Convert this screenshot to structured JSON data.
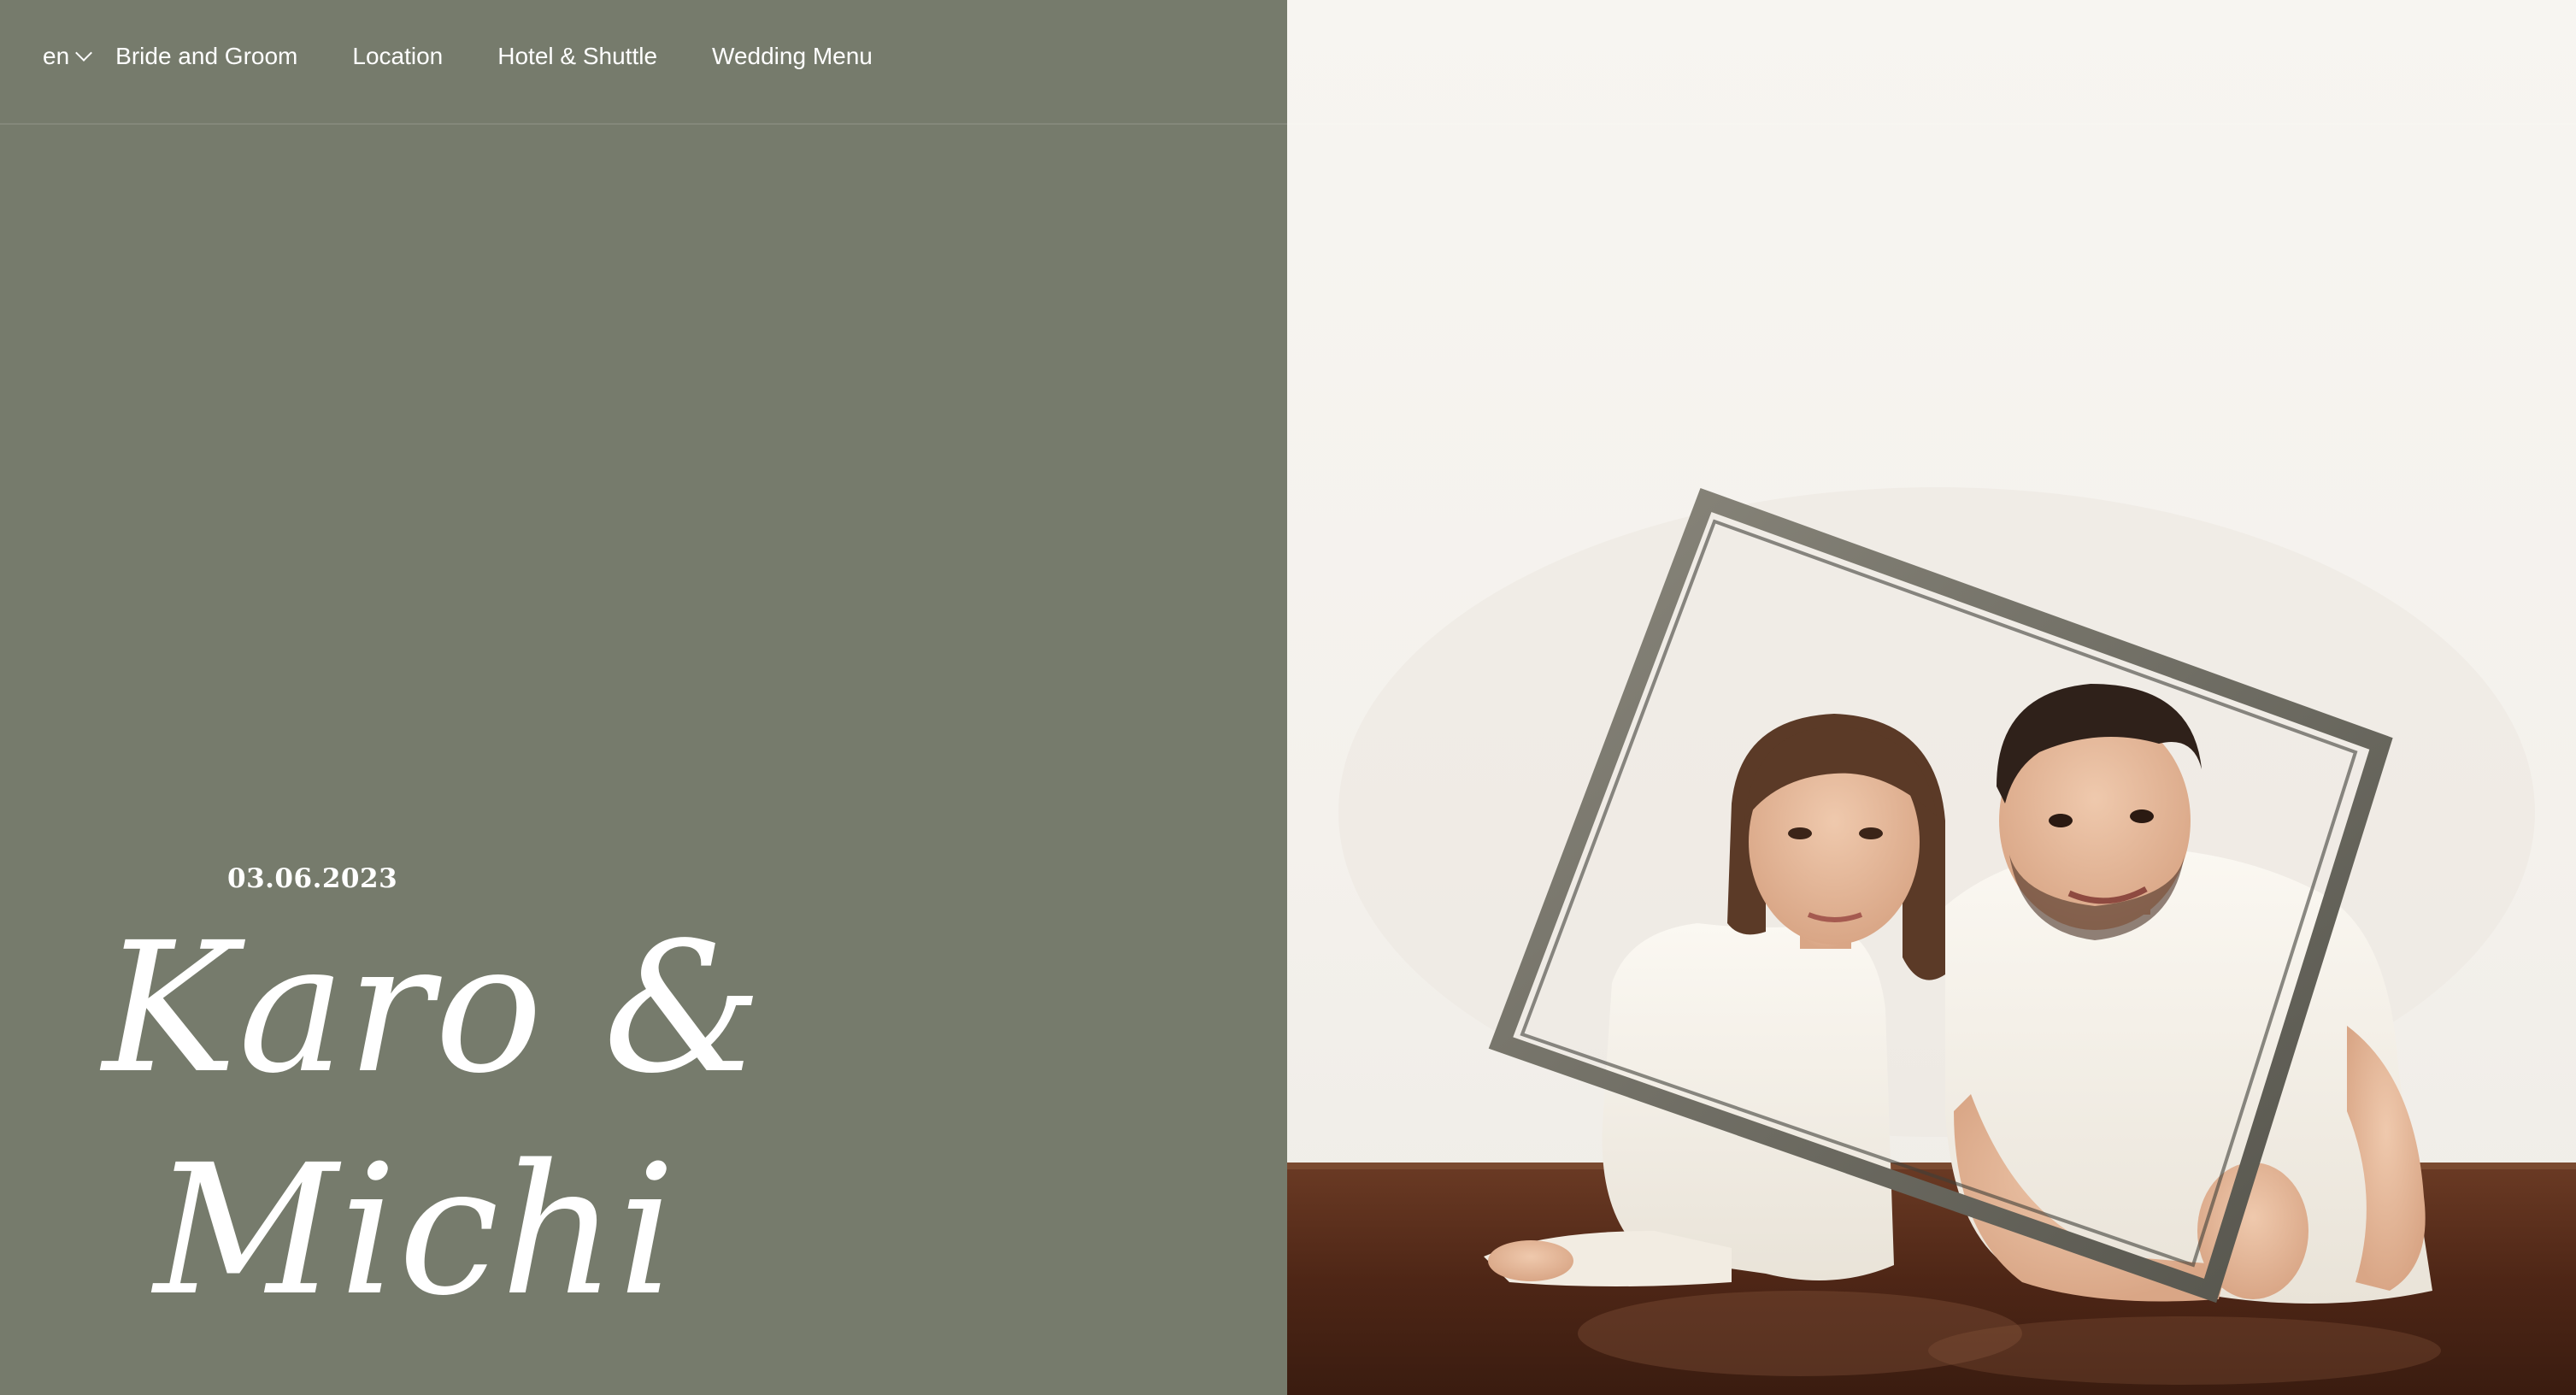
{
  "nav": {
    "language": "en",
    "links": [
      {
        "label": "Bride and Groom"
      },
      {
        "label": "Location"
      },
      {
        "label": "Hotel & Shuttle"
      },
      {
        "label": "Wedding Menu"
      }
    ]
  },
  "hero": {
    "date": "03.06.2023",
    "name_line1": "Karo &",
    "name_line2": "Michi"
  },
  "photo": {
    "subject": "couple-photo-with-frame"
  },
  "colors": {
    "left_panel": "#767b6c",
    "text": "#ffffff",
    "backdrop": "#f4f1ec",
    "floor": "#5a2e1c"
  }
}
